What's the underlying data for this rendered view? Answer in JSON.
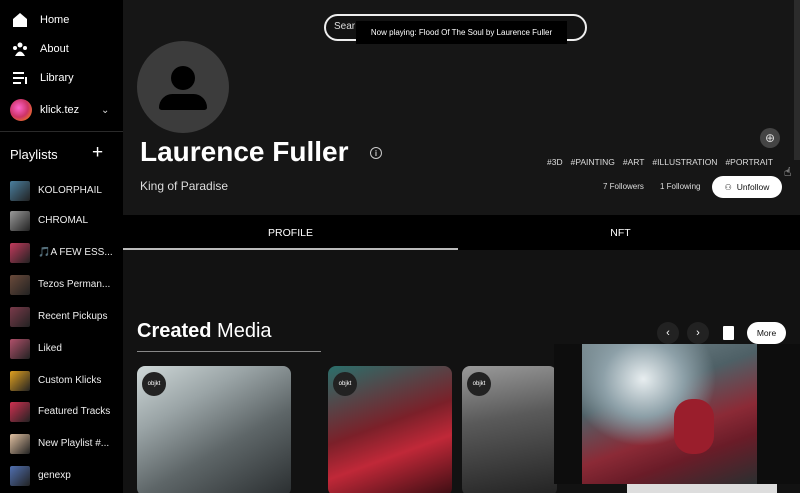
{
  "sidebar": {
    "nav": [
      {
        "label": "Home",
        "icon": "home-icon"
      },
      {
        "label": "About",
        "icon": "about-icon"
      },
      {
        "label": "Library",
        "icon": "library-icon"
      }
    ],
    "user": {
      "name": "klick.tez"
    },
    "playlists_title": "Playlists",
    "playlists": [
      {
        "label": "KOLORPHAIL",
        "color": "#4a7f9e"
      },
      {
        "label": "CHROMAL",
        "color": "#9a9a9a"
      },
      {
        "label": "🎵A FEW ESS...",
        "color": "#c23a5c"
      },
      {
        "label": "Tezos Perman...",
        "color": "#6a4a3a"
      },
      {
        "label": "Recent Pickups",
        "color": "#7a3a4a"
      },
      {
        "label": "Liked",
        "color": "#b0506a"
      },
      {
        "label": "Custom Klicks",
        "color": "#e0a020"
      },
      {
        "label": "Featured Tracks",
        "color": "#d03050"
      },
      {
        "label": "New Playlist #...",
        "color": "#e0c0a0"
      },
      {
        "label": "genexp",
        "color": "#5070b0"
      }
    ]
  },
  "search": {
    "placeholder": "Sear"
  },
  "tooltip": {
    "text": "Now playing: Flood Of The Soul by Laurence Fuller"
  },
  "profile": {
    "name": "Laurence Fuller",
    "subtitle": "King of Paradise",
    "tags": [
      "#3D",
      "#PAINTING",
      "#ART",
      "#ILLUSTRATION",
      "#PORTRAIT"
    ],
    "followers": "7 Followers",
    "following": "1 Following",
    "unfollow_label": "Unfollow"
  },
  "tabs": [
    {
      "label": "PROFILE",
      "active": true
    },
    {
      "label": "NFT",
      "active": false
    }
  ],
  "section": {
    "title_bold": "Created",
    "title_rest": " Media",
    "more_label": "More",
    "prev_label": "‹",
    "next_label": "›"
  },
  "cards": [
    {
      "badge": "objkt"
    },
    {
      "badge": "objkt"
    },
    {
      "badge": "objkt"
    }
  ]
}
